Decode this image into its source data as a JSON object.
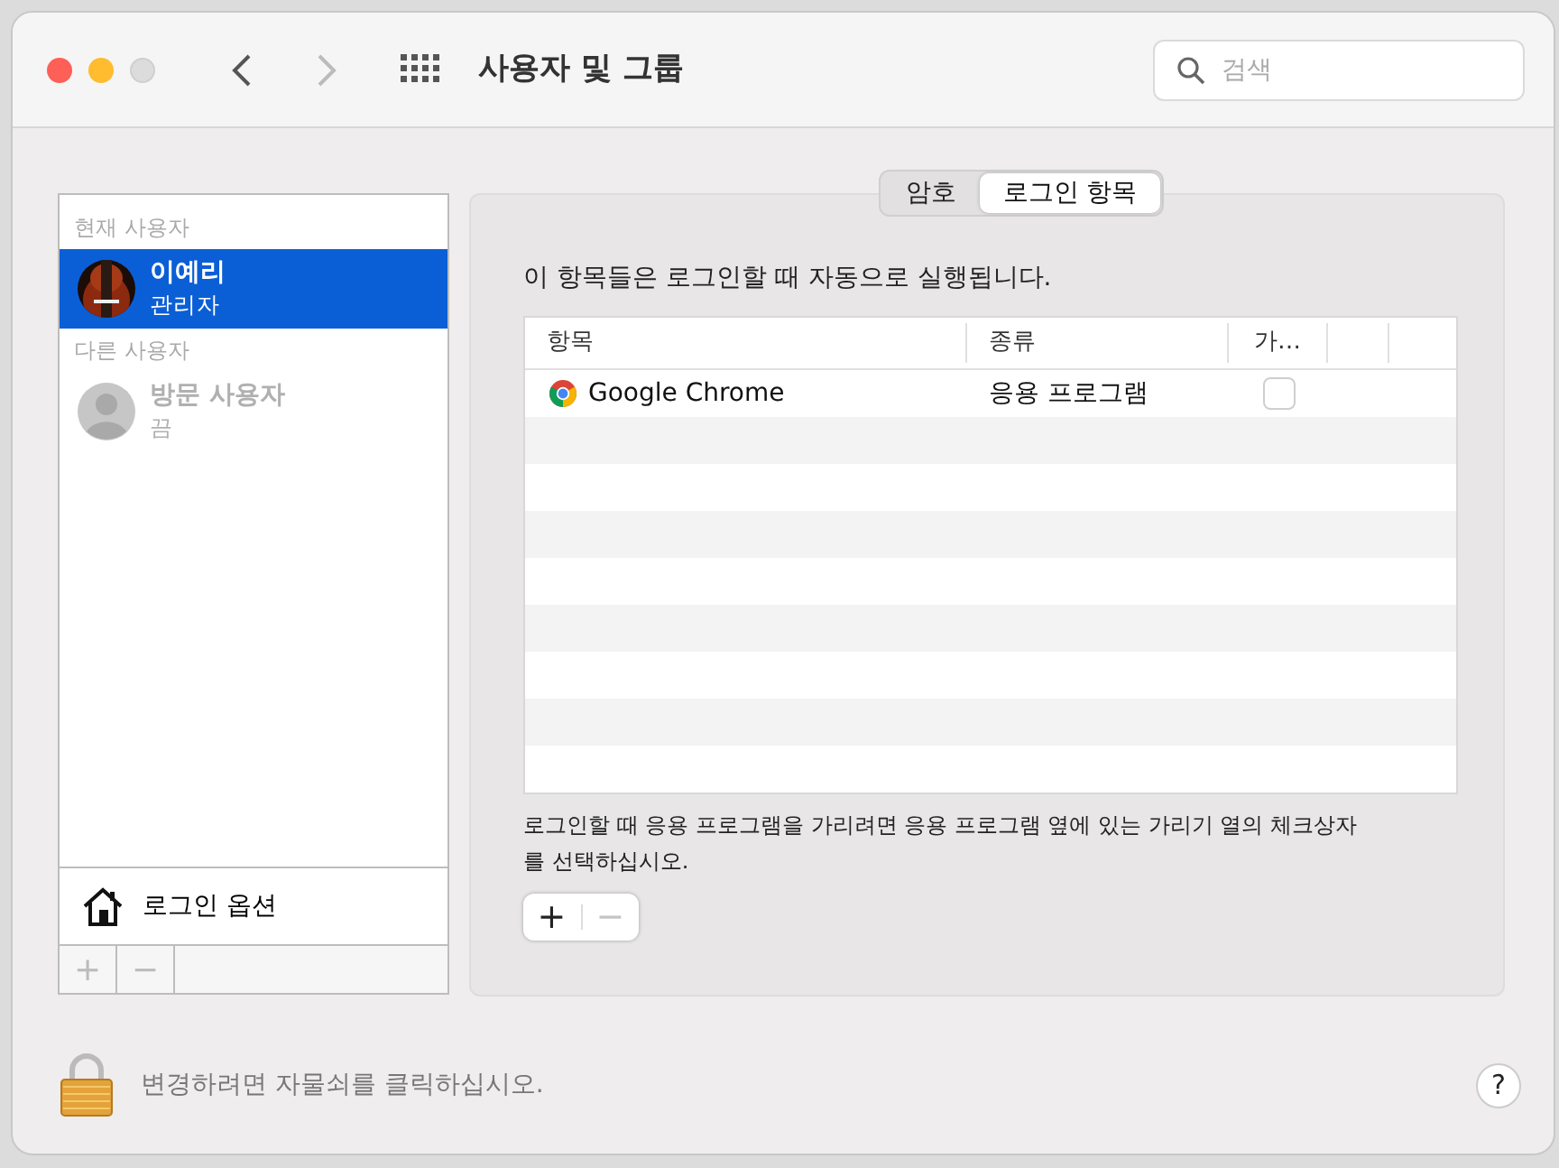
{
  "window": {
    "title": "사용자 및 그룹"
  },
  "navigation": {
    "back": {
      "disabled": false
    },
    "forward": {
      "disabled": true
    }
  },
  "search": {
    "placeholder": "검색"
  },
  "sidebar": {
    "sections": [
      {
        "heading": "현재 사용자",
        "users": [
          {
            "name": "이예리",
            "role": "관리자",
            "selected": true
          }
        ]
      },
      {
        "heading": "다른 사용자",
        "users": [
          {
            "name": "방문 사용자",
            "role": "끔",
            "selected": false,
            "kind": "generic",
            "disabled": true
          }
        ]
      }
    ],
    "login_options": "로그인 옵션",
    "buttons": [
      {
        "label": "+",
        "disabled": true
      },
      {
        "label": "−",
        "disabled": true
      }
    ]
  },
  "tabs": [
    {
      "label": "암호",
      "selected": false
    },
    {
      "label": "로그인 항목",
      "selected": true
    }
  ],
  "description": "이 항목들은 로그인할 때 자동으로 실행됩니다.",
  "table": {
    "columns": [
      "항목",
      "종류",
      "가…"
    ],
    "rows": [
      {
        "item": "Google Chrome",
        "type": "응용 프로그램",
        "hide": false
      }
    ]
  },
  "note": "로그인할 때 응용 프로그램을 가리려면 응용 프로그램 옆에 있는 가리기 열의 체크상자를 선택하십시오.",
  "item_buttons": [
    {
      "label": "+",
      "disabled": false
    },
    {
      "label": "−",
      "disabled": true
    }
  ],
  "footer": {
    "lock_text": "변경하려면 자물쇠를 클릭하십시오.",
    "help": "?"
  }
}
